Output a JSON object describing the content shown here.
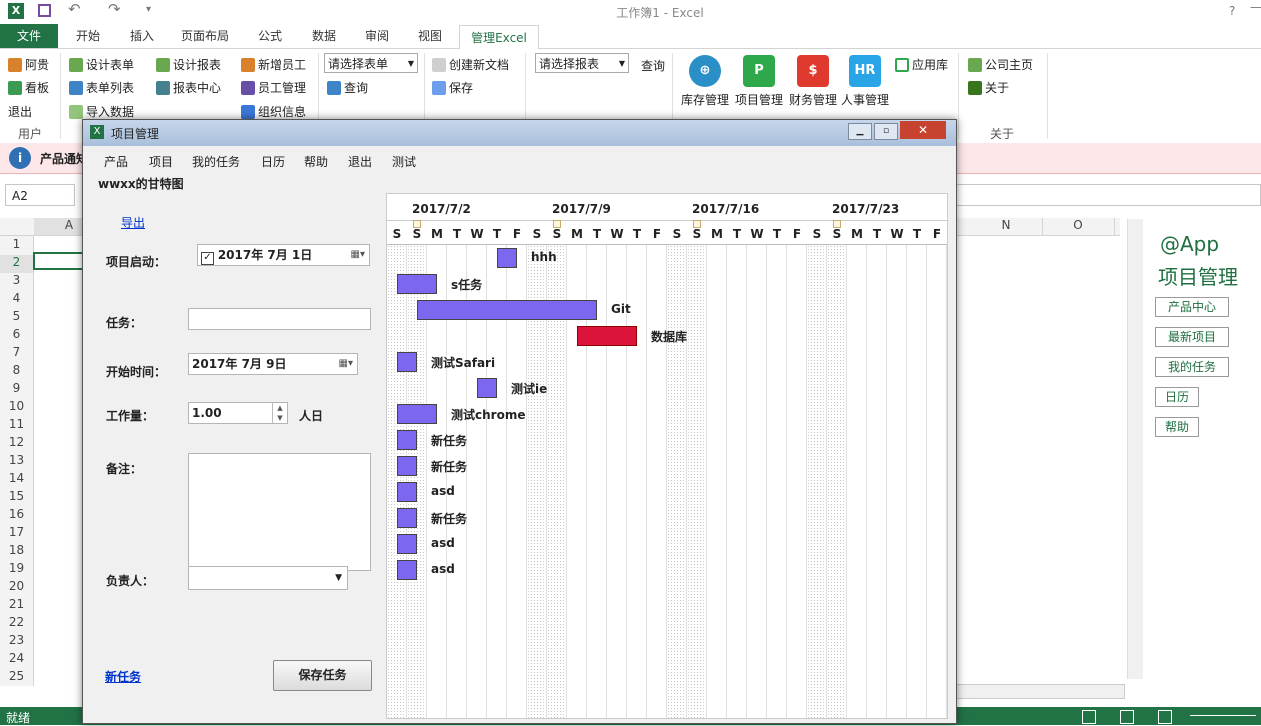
{
  "window": {
    "title": "工作簿1 - Excel",
    "help": "?"
  },
  "tabs": [
    {
      "label": "文件"
    },
    {
      "label": "开始"
    },
    {
      "label": "插入"
    },
    {
      "label": "页面布局"
    },
    {
      "label": "公式"
    },
    {
      "label": "数据"
    },
    {
      "label": "审阅"
    },
    {
      "label": "视图"
    },
    {
      "label": "管理Excel"
    }
  ],
  "ribbon": {
    "user": {
      "group": "用户",
      "items": [
        "阿贵",
        "看板",
        "退出"
      ]
    },
    "forms": {
      "items": [
        "设计表单",
        "表单列表",
        "导入数据"
      ]
    },
    "reports": {
      "items": [
        "设计报表",
        "报表中心"
      ]
    },
    "staff": {
      "items": [
        "新增员工",
        "员工管理",
        "组织信息"
      ]
    },
    "form_select": {
      "placeholder": "请选择表单",
      "query": "查询"
    },
    "docs": {
      "items": [
        "创建新文档",
        "保存"
      ]
    },
    "report_select": {
      "placeholder": "请选择报表",
      "query": "查询"
    },
    "apps": [
      {
        "label": "库存管理"
      },
      {
        "label": "项目管理"
      },
      {
        "label": "财务管理"
      },
      {
        "label": "人事管理"
      }
    ],
    "app_store": "应用库",
    "about": {
      "group": "关于",
      "items": [
        "公司主页",
        "关于"
      ]
    }
  },
  "infobar": {
    "text": "产品通知"
  },
  "namebox": "A2",
  "grid": {
    "rows": [
      "1",
      "2",
      "3",
      "4",
      "5",
      "6",
      "7",
      "8",
      "9",
      "10",
      "11",
      "12",
      "13",
      "14",
      "15",
      "16",
      "17",
      "18",
      "19",
      "20",
      "21",
      "22",
      "23",
      "24",
      "25"
    ],
    "cols_left": [
      "A"
    ],
    "cols_right": [
      "N",
      "O"
    ]
  },
  "dialog": {
    "title": "项目管理",
    "menu": [
      "产品",
      "项目",
      "我的任务",
      "日历",
      "帮助",
      "退出",
      "测试"
    ],
    "gantt_title": "wwxx的甘特图",
    "export_link": "导出",
    "form": {
      "start_label": "项目启动：",
      "start_value": "2017年  7月  1日",
      "start_checked": true,
      "task_label": "任务：",
      "task_value": "",
      "begin_label": "开始时间：",
      "begin_value": "2017年  7月  9日",
      "workload_label": "工作量：",
      "workload_value": "1.00",
      "workload_unit": "人日",
      "note_label": "备注：",
      "note_value": "",
      "owner_label": "负责人：",
      "owner_value": ""
    },
    "new_task_link": "新任务",
    "save_button": "保存任务"
  },
  "gantt": {
    "weeks": [
      "2017/7/2",
      "2017/7/9",
      "2017/7/16",
      "2017/7/23"
    ],
    "days": [
      "S",
      "S",
      "M",
      "T",
      "W",
      "T",
      "F",
      "S",
      "S",
      "M",
      "T",
      "W",
      "T",
      "F",
      "S",
      "S",
      "M",
      "T",
      "W",
      "T",
      "F",
      "S",
      "S",
      "M",
      "T",
      "W",
      "T",
      "F"
    ],
    "tasks": [
      {
        "name": "hhh",
        "start": 5,
        "duration": 1,
        "color": "#7b68ee"
      },
      {
        "name": "s任务",
        "start": 0,
        "duration": 2,
        "color": "#7b68ee"
      },
      {
        "name": "Git",
        "start": 1,
        "duration": 9,
        "color": "#7b68ee"
      },
      {
        "name": "数据库",
        "start": 9,
        "duration": 3,
        "color": "#dc143c"
      },
      {
        "name": "测试Safari",
        "start": 0,
        "duration": 1,
        "color": "#7b68ee"
      },
      {
        "name": "测试ie",
        "start": 4,
        "duration": 1,
        "color": "#7b68ee"
      },
      {
        "name": "测试chrome",
        "start": 0,
        "duration": 2,
        "color": "#7b68ee"
      },
      {
        "name": "新任务",
        "start": 0,
        "duration": 1,
        "color": "#7b68ee"
      },
      {
        "name": "新任务",
        "start": 0,
        "duration": 1,
        "color": "#7b68ee"
      },
      {
        "name": "asd",
        "start": 0,
        "duration": 1,
        "color": "#7b68ee"
      },
      {
        "name": "新任务",
        "start": 0,
        "duration": 1,
        "color": "#7b68ee"
      },
      {
        "name": "asd",
        "start": 0,
        "duration": 1,
        "color": "#7b68ee"
      },
      {
        "name": "asd",
        "start": 0,
        "duration": 1,
        "color": "#7b68ee"
      }
    ]
  },
  "side_panel": {
    "title1": "@App",
    "title2": "项目管理",
    "buttons": [
      "产品中心",
      "最新项目",
      "我的任务",
      "日历",
      "帮助"
    ]
  },
  "status": {
    "text": "就绪"
  },
  "colors": {
    "excel_green": "#217346",
    "task_purple": "#7b68ee",
    "task_red": "#dc143c"
  }
}
